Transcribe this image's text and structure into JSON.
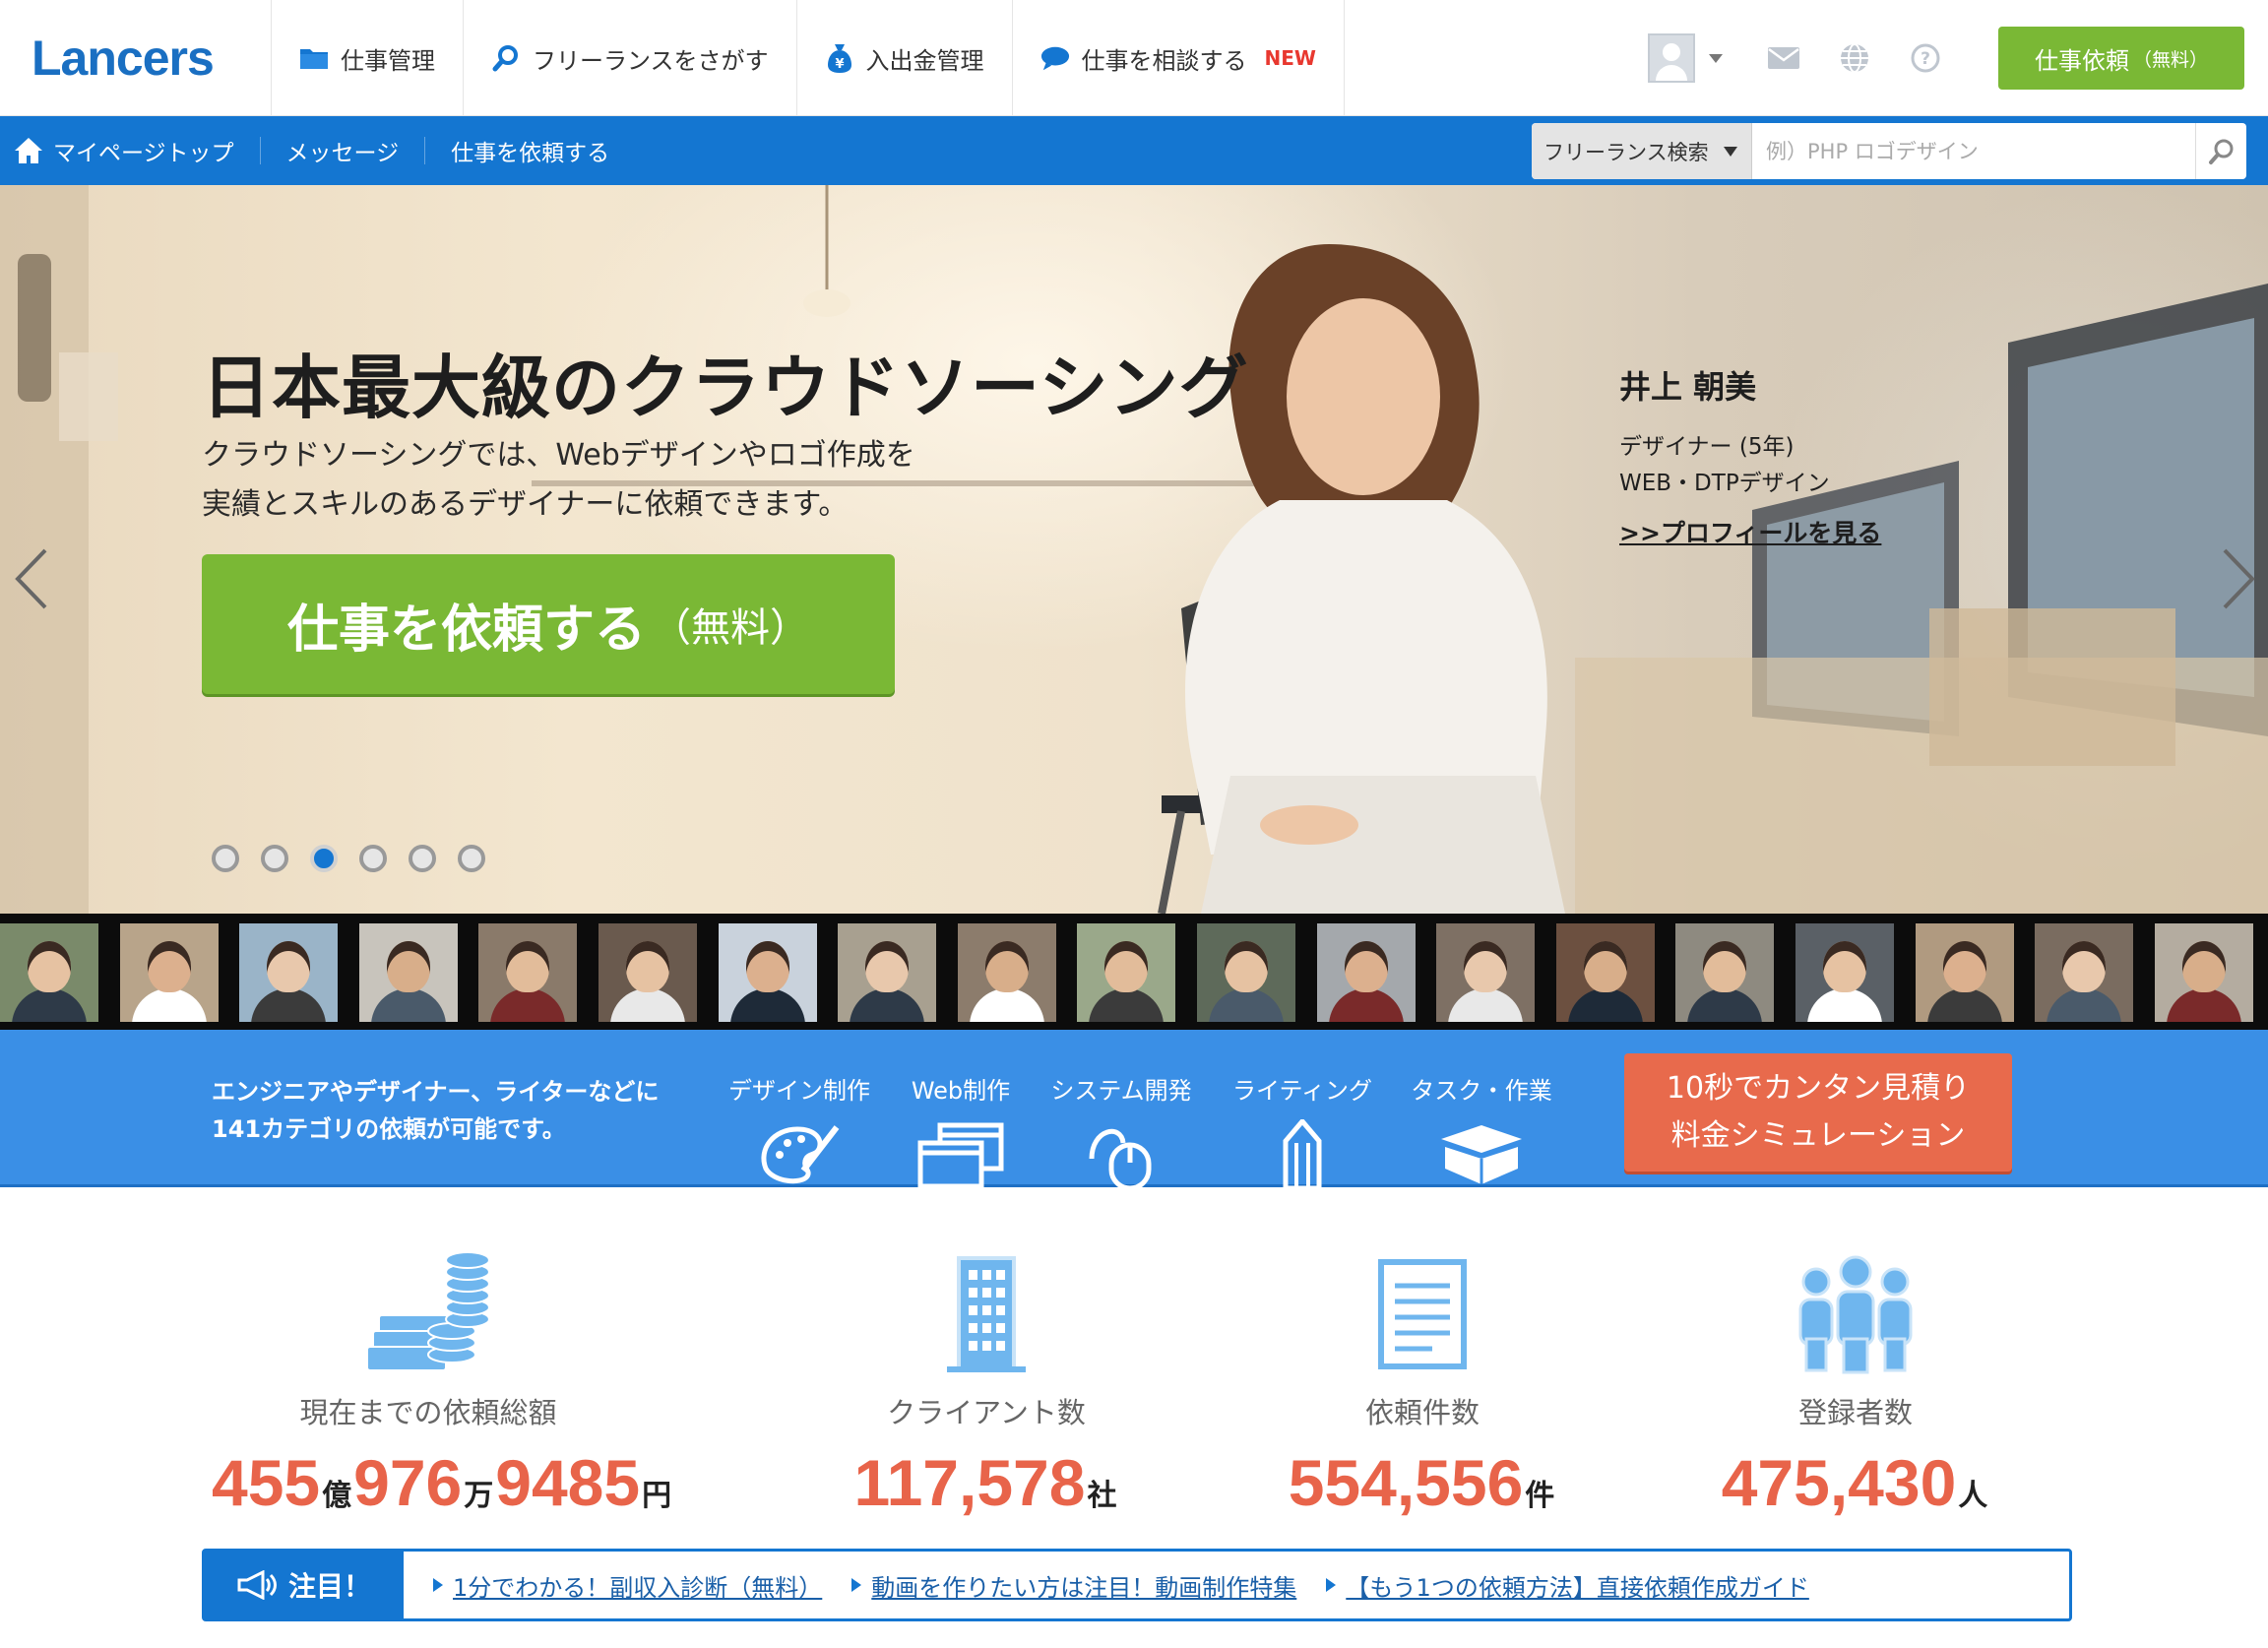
{
  "header": {
    "logo": "Lancers",
    "nav": [
      {
        "label": "仕事管理",
        "icon": "folder-icon"
      },
      {
        "label": "フリーランスをさがす",
        "icon": "search-icon"
      },
      {
        "label": "入出金管理",
        "icon": "money-bag-icon"
      },
      {
        "label": "仕事を相談する",
        "icon": "chat-bubble-icon",
        "badge": "NEW"
      }
    ],
    "request_button": "仕事依頼",
    "request_button_suffix": "（無料）"
  },
  "subnav": {
    "links": [
      "マイページトップ",
      "メッセージ",
      "仕事を依頼する"
    ],
    "search_type": "フリーランス検索",
    "search_placeholder": "例）PHP ロゴデザイン"
  },
  "hero": {
    "title": "日本最大級のクラウドソーシング",
    "subtitle_line1": "クラウドソーシングでは、Webデザインやロゴ作成を",
    "subtitle_line2": "実績とスキルのあるデザイナーに依頼できます。",
    "cta": "仕事を依頼する",
    "cta_suffix": "（無料）",
    "person_name": "井上 朝美",
    "person_role": "デザイナー (5年)",
    "person_skill": "WEB・DTPデザイン",
    "profile_link": ">>プロフィールを見る",
    "slides": 6,
    "active_slide": 3
  },
  "categories": {
    "lead_line1": "エンジニアやデザイナー、ライターなどに",
    "lead_line2": "141カテゴリの依頼が可能です。",
    "items": [
      {
        "label": "デザイン制作",
        "icon": "palette-icon"
      },
      {
        "label": "Web制作",
        "icon": "browser-windows-icon"
      },
      {
        "label": "システム開発",
        "icon": "mouse-icon"
      },
      {
        "label": "ライティング",
        "icon": "pencil-icon"
      },
      {
        "label": "タスク・作業",
        "icon": "box-icon"
      }
    ],
    "sim_line1": "10秒でカンタン見積り",
    "sim_line2": "料金シミュレーション"
  },
  "stats": [
    {
      "label": "現在までの依頼総額",
      "icon": "money-stack-icon",
      "parts": [
        {
          "n": "455",
          "u": "億"
        },
        {
          "n": "976",
          "u": "万"
        },
        {
          "n": "9485",
          "u": "円"
        }
      ]
    },
    {
      "label": "クライアント数",
      "icon": "building-icon",
      "parts": [
        {
          "n": "117,578",
          "u": "社"
        }
      ]
    },
    {
      "label": "依頼件数",
      "icon": "document-icon",
      "parts": [
        {
          "n": "554,556",
          "u": "件"
        }
      ]
    },
    {
      "label": "登録者数",
      "icon": "people-icon",
      "parts": [
        {
          "n": "475,430",
          "u": "人"
        }
      ]
    }
  ],
  "notice": {
    "tag": "注目！",
    "links": [
      "1分でわかる！副収入診断（無料）",
      "動画を作りたい方は注目！動画制作特集",
      "【もう1つの依頼方法】直接依頼作成ガイド"
    ]
  },
  "colors": {
    "brand_blue": "#1476d1",
    "green": "#7ab835",
    "category_blue": "#3a8fe6",
    "orange": "#e86a4c"
  }
}
